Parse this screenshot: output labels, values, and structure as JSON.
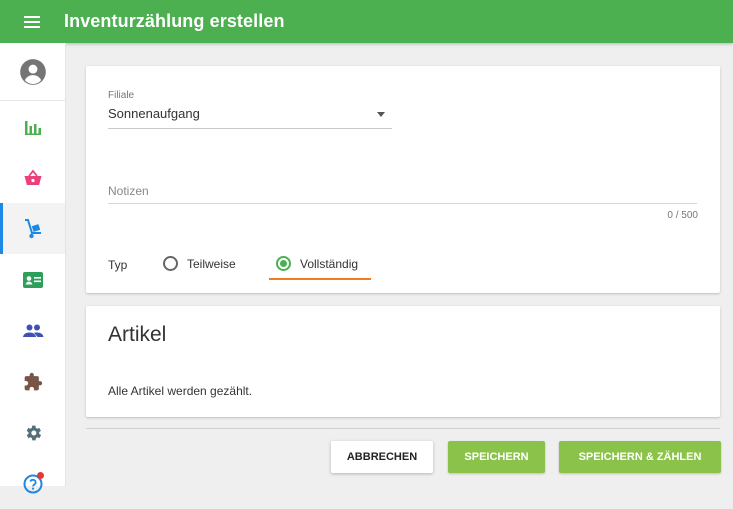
{
  "header": {
    "title": "Inventurzählung erstellen",
    "menu_icon": "hamburger-menu-icon",
    "color": "#4caf50"
  },
  "sidebar": {
    "active_index": 3,
    "items": [
      {
        "icon": "user-avatar-icon",
        "color": "#757575"
      },
      {
        "icon": "bar-chart-icon",
        "color": "#4caf50"
      },
      {
        "icon": "shopping-basket-icon",
        "color": "#ec407a"
      },
      {
        "icon": "hand-truck-icon",
        "color": "#1e88e5"
      },
      {
        "icon": "contact-card-icon",
        "color": "#2e9e5b"
      },
      {
        "icon": "people-icon",
        "color": "#3f51b5"
      },
      {
        "icon": "puzzle-piece-icon",
        "color": "#795548"
      },
      {
        "icon": "gear-icon",
        "color": "#546e7a"
      },
      {
        "icon": "help-icon",
        "color": "#1e88e5",
        "notification": true
      }
    ]
  },
  "form": {
    "branch_label": "Filiale",
    "branch_value": "Sonnenaufgang",
    "notes_placeholder": "Notizen",
    "notes_counter": "0 / 500",
    "type_label": "Typ",
    "type_options": [
      {
        "label": "Teilweise",
        "checked": false
      },
      {
        "label": "Vollständig",
        "checked": true
      }
    ]
  },
  "articles": {
    "title": "Artikel",
    "text": "Alle Artikel werden gezählt."
  },
  "actions": {
    "cancel": "ABBRECHEN",
    "save": "SPEICHERN",
    "save_count": "SPEICHERN & ZÄHLEN"
  },
  "colors": {
    "accent": "#4caf50",
    "button_green": "#8bc34a",
    "focus_orange": "#f47c20"
  }
}
